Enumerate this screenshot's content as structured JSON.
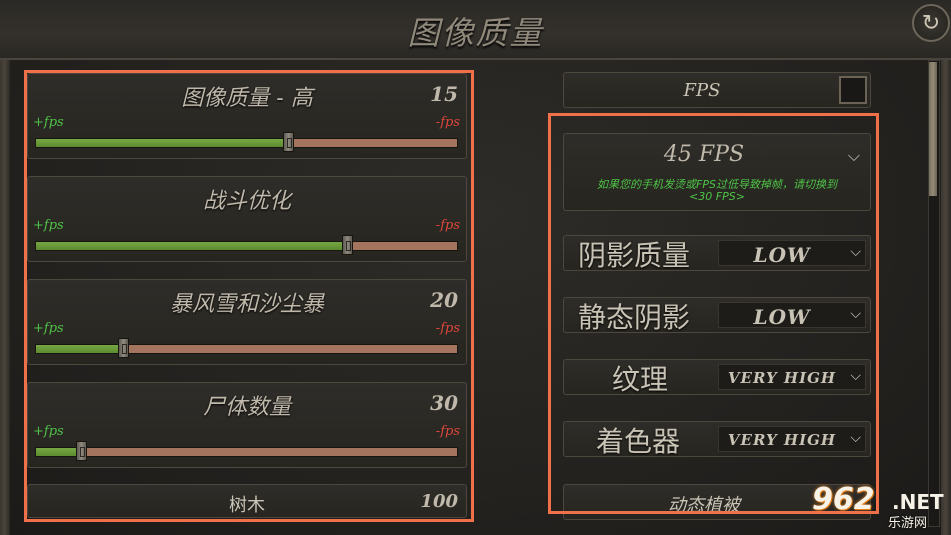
{
  "header": {
    "title": "图像质量"
  },
  "sliders": [
    {
      "label": "图像质量 - 高",
      "value": "15",
      "plus": "+fps",
      "minus": "-fps",
      "level": 0.6
    },
    {
      "label": "战斗优化",
      "value": "",
      "plus": "+fps",
      "minus": "-fps",
      "level": 0.74
    },
    {
      "label": "暴风雪和沙尘暴",
      "value": "20",
      "plus": "+fps",
      "minus": "-fps",
      "level": 0.21
    },
    {
      "label": "尸体数量",
      "value": "30",
      "plus": "+fps",
      "minus": "-fps",
      "level": 0.11
    }
  ],
  "tree_row": {
    "label": "树木",
    "value": "100"
  },
  "fps_toggle": {
    "label": "FPS",
    "checked": false
  },
  "fps_select": {
    "value": "45 FPS",
    "hint": "如果您的手机发烫或FPS过低导致掉帧，请切换到",
    "hint2": "<30 FPS>"
  },
  "dropdowns": [
    {
      "label": "阴影质量",
      "value": "LOW"
    },
    {
      "label": "静态阴影",
      "value": "LOW"
    },
    {
      "label": "纹理",
      "value": "VERY HIGH"
    },
    {
      "label": "着色器",
      "value": "VERY HIGH"
    }
  ],
  "vegetation_row": {
    "label": "动态植被"
  },
  "watermark": {
    "num": "962",
    "net": ".NET",
    "sub": "乐游网"
  },
  "colors": {
    "highlight": "#f0704a",
    "plus": "#4ec447",
    "minus": "#e0463c",
    "fill": "#78a844"
  }
}
